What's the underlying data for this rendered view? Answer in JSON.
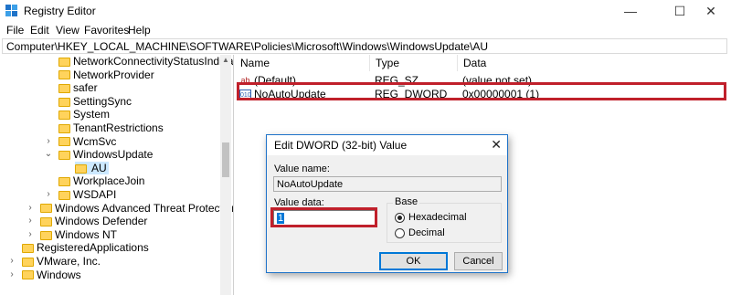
{
  "window": {
    "title": "Registry Editor",
    "controls": {
      "minimize": "—",
      "maximize": "☐",
      "close": "✕"
    }
  },
  "menu": [
    "File",
    "Edit",
    "View",
    "Favorites",
    "Help"
  ],
  "address": "Computer\\HKEY_LOCAL_MACHINE\\SOFTWARE\\Policies\\Microsoft\\Windows\\WindowsUpdate\\AU",
  "tree": [
    {
      "label": "NetworkConnectivityStatusIndicator",
      "level": 2,
      "expander": "",
      "selected": false
    },
    {
      "label": "NetworkProvider",
      "level": 2,
      "expander": "",
      "selected": false
    },
    {
      "label": "safer",
      "level": 2,
      "expander": "",
      "selected": false
    },
    {
      "label": "SettingSync",
      "level": 2,
      "expander": "",
      "selected": false
    },
    {
      "label": "System",
      "level": 2,
      "expander": "",
      "selected": false
    },
    {
      "label": "TenantRestrictions",
      "level": 2,
      "expander": "",
      "selected": false
    },
    {
      "label": "WcmSvc",
      "level": 2,
      "expander": "›",
      "selected": false
    },
    {
      "label": "WindowsUpdate",
      "level": 2,
      "expander": "⌄",
      "selected": false
    },
    {
      "label": "AU",
      "level": 3,
      "expander": "",
      "selected": true
    },
    {
      "label": "WorkplaceJoin",
      "level": 2,
      "expander": "",
      "selected": false
    },
    {
      "label": "WSDAPI",
      "level": 2,
      "expander": "›",
      "selected": false
    },
    {
      "label": "Windows Advanced Threat Protection",
      "level": 1,
      "expander": "›",
      "selected": false
    },
    {
      "label": "Windows Defender",
      "level": 1,
      "expander": "›",
      "selected": false
    },
    {
      "label": "Windows NT",
      "level": 1,
      "expander": "›",
      "selected": false
    },
    {
      "label": "RegisteredApplications",
      "level": 0,
      "expander": "",
      "selected": false
    },
    {
      "label": "VMware, Inc.",
      "level": 0,
      "expander": "›",
      "selected": false
    },
    {
      "label": "Windows",
      "level": 0,
      "expander": "›",
      "selected": false
    }
  ],
  "columns": {
    "name": "Name",
    "type": "Type",
    "data": "Data"
  },
  "values": [
    {
      "icon": "ab",
      "name": "(Default)",
      "type": "REG_SZ",
      "data": "(value not set)"
    },
    {
      "icon": "010",
      "name": "NoAutoUpdate",
      "type": "REG_DWORD",
      "data": "0x00000001 (1)"
    }
  ],
  "dialog": {
    "title": "Edit DWORD (32-bit) Value",
    "close": "✕",
    "value_name_label": "Value name:",
    "value_name": "NoAutoUpdate",
    "value_data_label": "Value data:",
    "value_data": "1",
    "base_label": "Base",
    "base_options": [
      {
        "label": "Hexadecimal",
        "checked": true
      },
      {
        "label": "Decimal",
        "checked": false
      }
    ],
    "ok": "OK",
    "cancel": "Cancel"
  },
  "colors": {
    "highlight": "#c0202b",
    "folder": "#ffd35c",
    "selection": "#cce8ff"
  }
}
